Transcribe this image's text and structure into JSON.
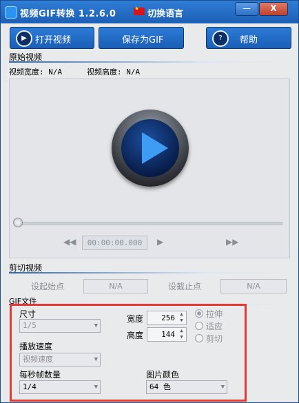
{
  "window": {
    "title": "视频GIF转换 1.2.6.0",
    "language_label": "切换语言",
    "minimize_glyph": "—",
    "close_glyph": "X"
  },
  "toolbar": {
    "open_label": "打开视频",
    "save_label": "保存为GIF",
    "help_label": "帮助"
  },
  "source_video": {
    "section_title": "原始视频",
    "width_label": "视频宽度: N/A",
    "height_label": "视频高度: N/A",
    "timecode": "00:00:00.000"
  },
  "trim": {
    "section_title": "剪切视频",
    "start_label": "设起始点",
    "start_value": "N/A",
    "end_label": "设截止点",
    "end_value": "N/A"
  },
  "gif": {
    "section_title": "GIF文件",
    "size_label": "尺寸",
    "size_value": "1/5",
    "width_label": "宽度",
    "width_value": "256",
    "height_label": "高度",
    "height_value": "144",
    "radio_stretch": "拉伸",
    "radio_fit": "适应",
    "radio_crop": "剪切",
    "speed_label": "播放速度",
    "speed_value": "视频速度",
    "fps_label": "每秒帧数量",
    "fps_value": "1/4",
    "color_label": "图片颜色",
    "color_value": "64 色"
  },
  "icons": {
    "play": "play-icon",
    "open": "play-circle-icon",
    "help": "question-icon",
    "rewind": "rewind-icon",
    "step": "step-forward-icon",
    "fast_forward": "fast-forward-icon"
  }
}
